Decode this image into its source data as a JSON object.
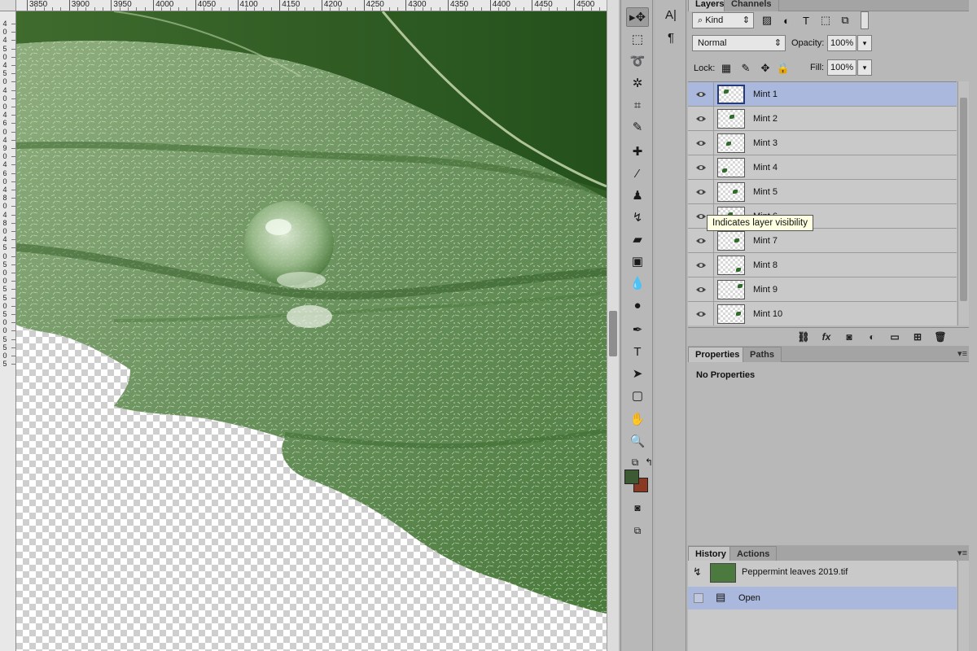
{
  "ruler": {
    "top_labels": [
      "3850",
      "3900",
      "3950",
      "4000",
      "4050",
      "4100",
      "4150",
      "4200",
      "4250",
      "4300",
      "4350",
      "4400",
      "4450",
      "4500"
    ],
    "left_labels": [
      "4",
      "0",
      "4",
      "5",
      "0",
      "4",
      "5",
      "0",
      "4",
      "0",
      "0",
      "4",
      "6",
      "0",
      "4",
      "9",
      "0",
      "4",
      "6",
      "0",
      "4",
      "8",
      "0",
      "4",
      "8",
      "0",
      "4",
      "5",
      "0",
      "5",
      "0",
      "0",
      "5",
      "5",
      "0",
      "5",
      "0",
      "0",
      "5",
      "5",
      "0",
      "5"
    ]
  },
  "toolbar": {
    "tools": [
      {
        "name": "move-tool",
        "icon": "move-icon",
        "glyph": "▸✥"
      },
      {
        "name": "marquee-tool",
        "icon": "rectangular-marquee-icon",
        "glyph": "⬚"
      },
      {
        "name": "lasso-tool",
        "icon": "lasso-icon",
        "glyph": "➰"
      },
      {
        "name": "magic-wand-tool",
        "icon": "magic-wand-icon",
        "glyph": "✲"
      },
      {
        "name": "crop-tool",
        "icon": "crop-icon",
        "glyph": "⌗"
      },
      {
        "name": "eyedropper-tool",
        "icon": "eyedropper-icon",
        "glyph": "✎"
      },
      {
        "name": "healing-brush-tool",
        "icon": "bandage-icon",
        "glyph": "✚"
      },
      {
        "name": "brush-tool",
        "icon": "brush-icon",
        "glyph": "⁄"
      },
      {
        "name": "clone-stamp-tool",
        "icon": "stamp-icon",
        "glyph": "♟"
      },
      {
        "name": "history-brush-tool",
        "icon": "history-brush-icon",
        "glyph": "↯"
      },
      {
        "name": "eraser-tool",
        "icon": "eraser-icon",
        "glyph": "▰"
      },
      {
        "name": "gradient-tool",
        "icon": "gradient-icon",
        "glyph": "▣"
      },
      {
        "name": "blur-tool",
        "icon": "drop-icon",
        "glyph": "💧"
      },
      {
        "name": "dodge-tool",
        "icon": "dodge-icon",
        "glyph": "●"
      },
      {
        "name": "pen-tool",
        "icon": "pen-icon",
        "glyph": "✒"
      },
      {
        "name": "type-tool",
        "icon": "type-icon",
        "glyph": "T"
      },
      {
        "name": "path-selection-tool",
        "icon": "arrow-icon",
        "glyph": "➤"
      },
      {
        "name": "shape-tool",
        "icon": "rounded-rectangle-icon",
        "glyph": "▢"
      },
      {
        "name": "hand-tool",
        "icon": "hand-icon",
        "glyph": "✋"
      },
      {
        "name": "zoom-tool",
        "icon": "zoom-icon",
        "glyph": "🔍"
      }
    ],
    "foreground_color": "#3d5a34",
    "background_color": "#8a3a22"
  },
  "sidebar": {
    "items": [
      {
        "name": "character-panel-button",
        "icon": "character-icon",
        "glyph": "A|"
      },
      {
        "name": "paragraph-panel-button",
        "icon": "paragraph-icon",
        "glyph": "¶"
      }
    ]
  },
  "layers_panel": {
    "tabs": [
      "Layers",
      "Channels"
    ],
    "filter_kind": "Kind",
    "blend_mode": "Normal",
    "opacity_label": "Opacity:",
    "opacity_value": "100%",
    "lock_label": "Lock:",
    "fill_label": "Fill:",
    "fill_value": "100%",
    "layers": [
      {
        "name": "Mint 1",
        "selected": true
      },
      {
        "name": "Mint 2",
        "selected": false
      },
      {
        "name": "Mint 3",
        "selected": false
      },
      {
        "name": "Mint 4",
        "selected": false
      },
      {
        "name": "Mint 5",
        "selected": false
      },
      {
        "name": "Mint 6",
        "selected": false
      },
      {
        "name": "Mint 7",
        "selected": false
      },
      {
        "name": "Mint 8",
        "selected": false
      },
      {
        "name": "Mint 9",
        "selected": false
      },
      {
        "name": "Mint 10",
        "selected": false
      }
    ],
    "tooltip": "Indicates layer visibility"
  },
  "properties_panel": {
    "tabs": [
      "Properties",
      "Paths"
    ],
    "content": "No Properties"
  },
  "history_panel": {
    "tabs": [
      "History",
      "Actions"
    ],
    "snapshot": "Peppermint leaves 2019.tif",
    "states": [
      "Open"
    ]
  },
  "colors": {
    "selection": "#a9b8dc",
    "panel_bg": "#b8b8b8"
  }
}
